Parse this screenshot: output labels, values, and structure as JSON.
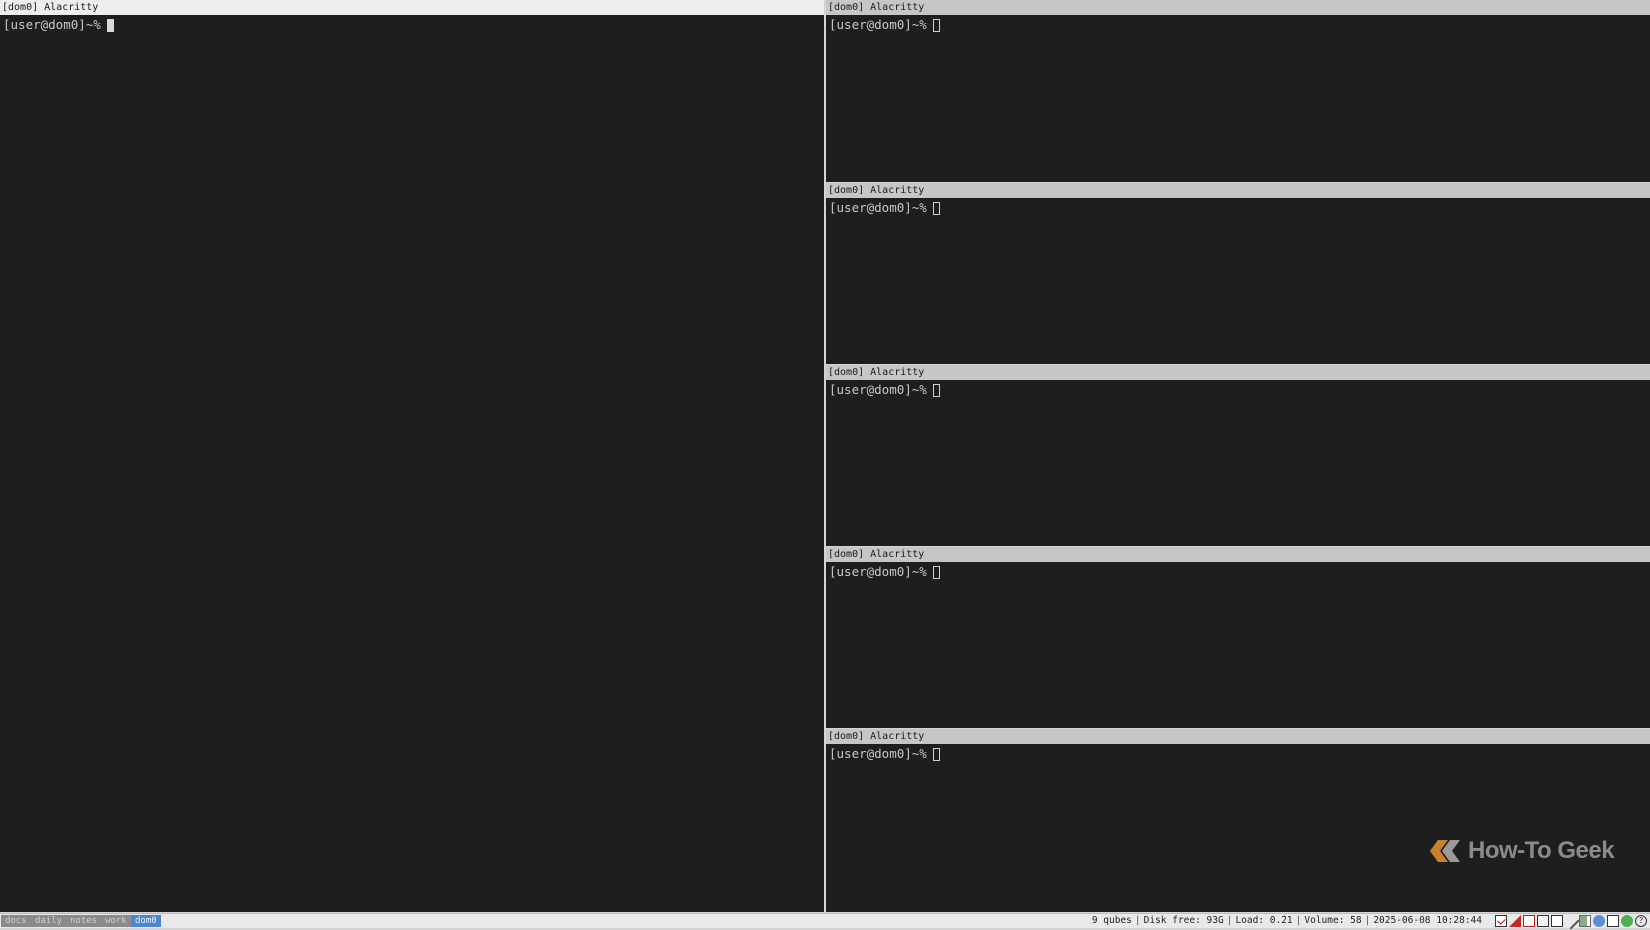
{
  "windows": [
    {
      "title": "[dom0] Alacritty",
      "prompt": "[user@dom0]~%",
      "focused": true
    },
    {
      "title": "[dom0] Alacritty",
      "prompt": "[user@dom0]~%",
      "focused": false
    },
    {
      "title": "[dom0] Alacritty",
      "prompt": "[user@dom0]~%",
      "focused": false
    },
    {
      "title": "[dom0] Alacritty",
      "prompt": "[user@dom0]~%",
      "focused": false
    },
    {
      "title": "[dom0] Alacritty",
      "prompt": "[user@dom0]~%",
      "focused": false
    },
    {
      "title": "[dom0] Alacritty",
      "prompt": "[user@dom0]~%",
      "focused": false
    }
  ],
  "workspaces": [
    {
      "label": "docs",
      "active": false
    },
    {
      "label": "daily",
      "active": false
    },
    {
      "label": "notes",
      "active": false
    },
    {
      "label": "work",
      "active": false
    },
    {
      "label": "dom0",
      "active": true
    }
  ],
  "status": {
    "qubes": "9 qubes",
    "disk": "Disk free: 93G",
    "load": "Load: 0.21",
    "volume": "Volume: 58",
    "datetime": "2025-06-08 10:28:44"
  },
  "tray_icons": [
    "mail-icon",
    "red-flag-icon",
    "mail-red-icon",
    "mail-icon",
    "window-icon",
    "pen-icon",
    "battery-icon",
    "network-icon",
    "mail-icon",
    "status-dot-icon",
    "help-icon"
  ],
  "watermark": {
    "text": "How-To Geek",
    "color": "#8b8b8b",
    "accent": "#c8822c"
  },
  "colors": {
    "terminal_bg": "#1e1e20",
    "workspace_active": "#4d86cf"
  }
}
